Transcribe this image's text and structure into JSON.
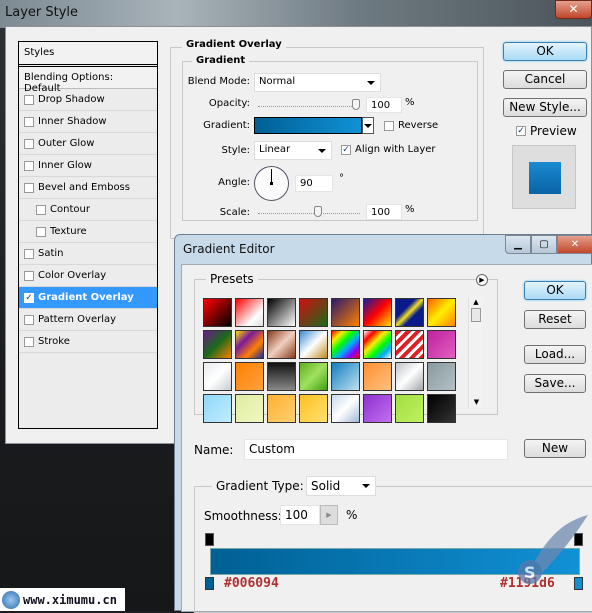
{
  "layer_style": {
    "title": "Layer Style",
    "styles_header": "Styles",
    "blending_options": "Blending Options: Default",
    "items": [
      {
        "label": "Drop Shadow",
        "checked": false,
        "indent": false,
        "active": false
      },
      {
        "label": "Inner Shadow",
        "checked": false,
        "indent": false,
        "active": false
      },
      {
        "label": "Outer Glow",
        "checked": false,
        "indent": false,
        "active": false
      },
      {
        "label": "Inner Glow",
        "checked": false,
        "indent": false,
        "active": false
      },
      {
        "label": "Bevel and Emboss",
        "checked": false,
        "indent": false,
        "active": false
      },
      {
        "label": "Contour",
        "checked": false,
        "indent": true,
        "active": false
      },
      {
        "label": "Texture",
        "checked": false,
        "indent": true,
        "active": false
      },
      {
        "label": "Satin",
        "checked": false,
        "indent": false,
        "active": false
      },
      {
        "label": "Color Overlay",
        "checked": false,
        "indent": false,
        "active": false
      },
      {
        "label": "Gradient Overlay",
        "checked": true,
        "indent": false,
        "active": true
      },
      {
        "label": "Pattern Overlay",
        "checked": false,
        "indent": false,
        "active": false
      },
      {
        "label": "Stroke",
        "checked": false,
        "indent": false,
        "active": false
      }
    ],
    "panel": {
      "section_title": "Gradient Overlay",
      "group_title": "Gradient",
      "blend_mode_label": "Blend Mode:",
      "blend_mode_value": "Normal",
      "opacity_label": "Opacity:",
      "opacity_value": "100",
      "opacity_unit": "%",
      "gradient_label": "Gradient:",
      "reverse_label": "Reverse",
      "reverse_checked": false,
      "style_label": "Style:",
      "style_value": "Linear",
      "align_label": "Align with Layer",
      "align_checked": true,
      "angle_label": "Angle:",
      "angle_value": "90",
      "angle_unit": "°",
      "scale_label": "Scale:",
      "scale_value": "100",
      "scale_unit": "%"
    },
    "buttons": {
      "ok": "OK",
      "cancel": "Cancel",
      "new_style": "New Style..."
    },
    "preview_label": "Preview",
    "preview_checked": true
  },
  "gradient_editor": {
    "title": "Gradient Editor",
    "presets_label": "Presets",
    "buttons": {
      "ok": "OK",
      "reset": "Reset",
      "load": "Load...",
      "save": "Save...",
      "new": "New"
    },
    "name_label": "Name:",
    "name_value": "Custom",
    "gradient_type_label": "Gradient Type:",
    "gradient_type_value": "Solid",
    "smoothness_label": "Smoothness:",
    "smoothness_value": "100",
    "smoothness_unit": "%",
    "color_stop_left": "#006094",
    "color_stop_right": "#1191d6",
    "presets": [
      "linear-gradient(135deg,#ff0000,#000)",
      "linear-gradient(135deg,#ff0000,#fff 70%,#ddd)",
      "linear-gradient(135deg,#000,#fff)",
      "linear-gradient(135deg,#d01010,#1a6a1a)",
      "linear-gradient(135deg,#2a1a6a,#ff8000)",
      "linear-gradient(135deg,#1a1aa0,#ff0000,#ffe000)",
      "linear-gradient(135deg,#0a1a8a 35%,#f0e020 50%,#0a1a8a 65%)",
      "linear-gradient(135deg,#ff6000,#ffee00,#ff8000)",
      "linear-gradient(135deg,#6a1a8a,#1a6a1a,#ff8000)",
      "linear-gradient(135deg,#ffe000,#7a1a9a,#ff8000,#1a2a9a)",
      "linear-gradient(135deg,#8a3a1a,#f0d0c0,#8a3a1a)",
      "linear-gradient(135deg,#3a8ad0,#fff,#c08a20)",
      "linear-gradient(135deg,#ff0000,#ffee00,#00ff00,#00aaff,#8800ff,#ff0000)",
      "linear-gradient(135deg,#fff,#ff0000,#ffee00,#00ff00,#00aaff,#fff)",
      "repeating-linear-gradient(135deg,#e02020 0 4px,#fff 4px 7px)",
      "linear-gradient(135deg,#c020a0,#e060c0)",
      "linear-gradient(135deg,#e8ecf0,#fff,#c8ccd0)",
      "linear-gradient(135deg,#ff8000,#ffa040)",
      "linear-gradient(180deg,#111,#888)",
      "linear-gradient(135deg,#60b020,#a0e060,#40a010)",
      "linear-gradient(135deg,#1080c0,#c0e0f0)",
      "linear-gradient(135deg,#ff9030,#ffc080)",
      "linear-gradient(135deg,#c0c4c8,#fff,#a0a4a8)",
      "linear-gradient(135deg,#8a9aa0,#b0c0c4)",
      "linear-gradient(135deg,#90d8f8,#c0ecff)",
      "linear-gradient(135deg,#e0ec a0,#f0f8c0)",
      "linear-gradient(135deg,#ffb030,#ffd070)",
      "linear-gradient(135deg,#ffc020,#ffe070)",
      "linear-gradient(135deg,#c8d8ec,#fff,#a0b8d8)",
      "linear-gradient(135deg,#9030d0,#c070f0)",
      "linear-gradient(135deg,#a0e040,#c0f060)",
      "linear-gradient(135deg,#000,#333)"
    ]
  },
  "watermark": {
    "site": "www.ximumu.cn"
  }
}
